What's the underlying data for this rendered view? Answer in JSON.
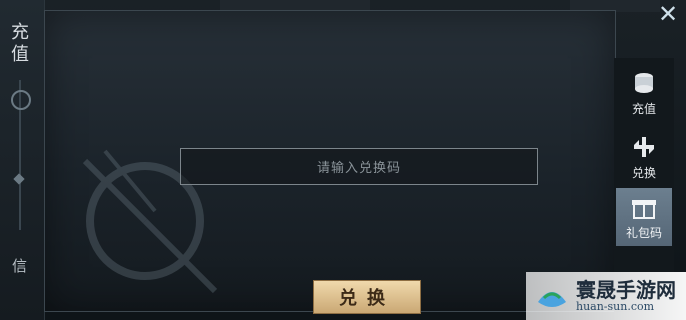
{
  "left_panel": {
    "title": "充值",
    "bottom_label": "信"
  },
  "redeem_panel": {
    "placeholder": "请输入兑换码",
    "redeem_button": "兑换"
  },
  "tabs": [
    {
      "label": "充值",
      "icon": "coins-stack-icon"
    },
    {
      "label": "兑换",
      "icon": "exchange-icon"
    },
    {
      "label": "礼包码",
      "icon": "gift-box-icon",
      "active": true
    }
  ],
  "close_icon": "close-icon",
  "watermark": {
    "title": "寰晟手游网",
    "subtitle": "huan-sun.com"
  },
  "colors": {
    "accent_gold": "#caa874",
    "tab_active": "#6c7f8f"
  }
}
